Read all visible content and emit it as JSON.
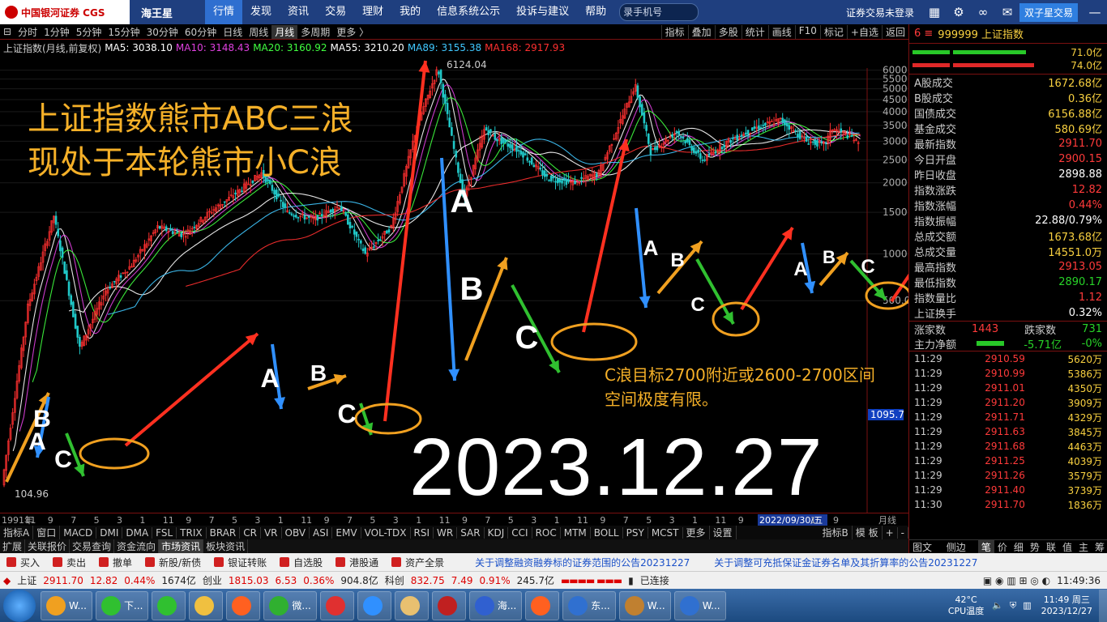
{
  "top": {
    "brand": "中国银河证券 CGS",
    "app_name": "海王星",
    "nav": [
      "行情",
      "发现",
      "资讯",
      "交易",
      "理财",
      "我的",
      "信息系统公示",
      "投诉与建议",
      "帮助"
    ],
    "search_placeholder": "录手机号",
    "login_status": "证券交易未登录",
    "account_button": "双子星交易"
  },
  "period_bar": {
    "items": [
      "分时",
      "1分钟",
      "5分钟",
      "15分钟",
      "30分钟",
      "60分钟",
      "日线",
      "周线",
      "月线",
      "多周期",
      "更多 〉"
    ],
    "selected": "月线",
    "right_items": [
      "指标",
      "叠加",
      "多股",
      "统计",
      "画线",
      "F10",
      "标记",
      "+自选",
      "返回"
    ]
  },
  "chart_header": {
    "name": "上证指数(月线,前复权)",
    "ma5": "MA5: 3038.10",
    "ma10": "MA10: 3148.43",
    "ma20": "MA20: 3160.92",
    "ma55": "MA55: 3210.20",
    "ma89": "MA89: 3155.38",
    "ma168": "MA168: 2917.93"
  },
  "annotations": {
    "headline1": "上证指数熊市ABC三浪",
    "headline2": "现处于本轮熊市小C浪",
    "target1": "C浪目标2700附近或2600-2700区间",
    "target2": "空间极度有限。",
    "date": "2023.12.27",
    "high_label": "6124.04",
    "low_label": "104.96",
    "price_tag": "1095.7",
    "wave_labels": [
      {
        "t": "A",
        "x": 46,
        "y": 555,
        "s": 30
      },
      {
        "t": "B",
        "x": 52,
        "y": 527,
        "s": 30
      },
      {
        "t": "C",
        "x": 78,
        "y": 577,
        "s": 30
      },
      {
        "t": "A",
        "x": 333,
        "y": 478,
        "s": 32
      },
      {
        "t": "B",
        "x": 393,
        "y": 470,
        "s": 28
      },
      {
        "t": "C",
        "x": 428,
        "y": 522,
        "s": 32
      },
      {
        "t": "A",
        "x": 570,
        "y": 262,
        "s": 40
      },
      {
        "t": "B",
        "x": 582,
        "y": 370,
        "s": 40
      },
      {
        "t": "C",
        "x": 650,
        "y": 430,
        "s": 40
      },
      {
        "t": "A",
        "x": 803,
        "y": 315,
        "s": 26
      },
      {
        "t": "B",
        "x": 836,
        "y": 329,
        "s": 24
      },
      {
        "t": "C",
        "x": 861,
        "y": 384,
        "s": 24
      },
      {
        "t": "A",
        "x": 988,
        "y": 340,
        "s": 24
      },
      {
        "t": "B",
        "x": 1023,
        "y": 325,
        "s": 22
      },
      {
        "t": "C",
        "x": 1071,
        "y": 337,
        "s": 24
      }
    ]
  },
  "chart_data": {
    "type": "candlestick",
    "title": "上证指数(月线,前复权)",
    "y_ticks": [
      500,
      1000,
      1500,
      2000,
      2500,
      3000,
      3500,
      4000,
      4500,
      5000,
      5500,
      6000
    ],
    "x_ticks": [
      "1991年",
      "11",
      "9",
      "7",
      "5",
      "3",
      "1",
      "11",
      "9",
      "7",
      "5",
      "3",
      "1",
      "11",
      "9",
      "7",
      "5",
      "3",
      "1",
      "11",
      "9",
      "7",
      "5",
      "3",
      "1",
      "11",
      "9",
      "7",
      "5",
      "3",
      "1",
      "11",
      "9",
      "7",
      "2022/09/30/五",
      "1",
      "9",
      "月线"
    ],
    "series": [
      {
        "name": "MA5",
        "color": "#ffffff"
      },
      {
        "name": "MA10",
        "color": "#e040e0"
      },
      {
        "name": "MA20",
        "color": "#40ff40"
      },
      {
        "name": "MA55",
        "color": "#ffffff"
      },
      {
        "name": "MA89",
        "color": "#40c8ff"
      },
      {
        "name": "MA168",
        "color": "#ff3030"
      }
    ],
    "path_points": [
      [
        1991,
        105
      ],
      [
        1992,
        600
      ],
      [
        1993,
        1450
      ],
      [
        1994,
        400
      ],
      [
        1995,
        700
      ],
      [
        1996,
        900
      ],
      [
        1997,
        1300
      ],
      [
        1998,
        1200
      ],
      [
        1999,
        1500
      ],
      [
        2000,
        1800
      ],
      [
        2001,
        2200
      ],
      [
        2002,
        1500
      ],
      [
        2003,
        1400
      ],
      [
        2004,
        1600
      ],
      [
        2005,
        1000
      ],
      [
        2006,
        1300
      ],
      [
        2007,
        3500
      ],
      [
        2007.8,
        6124
      ],
      [
        2008.8,
        1700
      ],
      [
        2009.6,
        3400
      ],
      [
        2010,
        3100
      ],
      [
        2011,
        2700
      ],
      [
        2012,
        2100
      ],
      [
        2013,
        2000
      ],
      [
        2014,
        2200
      ],
      [
        2015.4,
        5178
      ],
      [
        2016,
        2700
      ],
      [
        2017,
        3300
      ],
      [
        2018,
        2500
      ],
      [
        2019,
        3000
      ],
      [
        2020,
        3400
      ],
      [
        2021,
        3700
      ],
      [
        2022,
        3000
      ],
      [
        2022.7,
        2900
      ],
      [
        2023,
        3400
      ],
      [
        2023.8,
        3100
      ],
      [
        2023.99,
        2911.7
      ]
    ]
  },
  "bottom_axis_label": "月线",
  "indicator_tabs": [
    "指标A",
    "窗口",
    "MACD",
    "DMI",
    "DMA",
    "FSL",
    "TRIX",
    "BRAR",
    "CR",
    "VR",
    "OBV",
    "ASI",
    "EMV",
    "VOL-TDX",
    "RSI",
    "WR",
    "SAR",
    "KDJ",
    "CCI",
    "ROC",
    "MTM",
    "BOLL",
    "PSY",
    "MCST",
    "更多",
    "设置",
    "指标B",
    "模 板",
    "+",
    "-"
  ],
  "bottom_tabs": [
    "扩展",
    "关联报价",
    "交易查询",
    "资金流向",
    "市场资讯",
    "板块资讯"
  ],
  "bottom_tabs_selected": "市场资讯",
  "bottom_right": [
    "图文F10",
    "侧边栏《",
    "笔",
    "价",
    "细",
    "势",
    "联",
    "值",
    "主",
    "筹"
  ],
  "quote": {
    "code_title": "999999 上证指数",
    "bar1": "71.0亿",
    "bar2": "74.0亿",
    "rows": [
      {
        "label": "A股成交",
        "value": "1672.68亿",
        "c": "yel"
      },
      {
        "label": "B股成交",
        "value": "0.36亿",
        "c": "yel"
      },
      {
        "label": "国债成交",
        "value": "6156.88亿",
        "c": "yel"
      },
      {
        "label": "基金成交",
        "value": "580.69亿",
        "c": "yel"
      },
      {
        "label": "最新指数",
        "value": "2911.70",
        "c": "red"
      },
      {
        "label": "今日开盘",
        "value": "2900.15",
        "c": "red"
      },
      {
        "label": "昨日收盘",
        "value": "2898.88",
        "c": "wht"
      },
      {
        "label": "指数涨跌",
        "value": "12.82",
        "c": "red"
      },
      {
        "label": "指数涨幅",
        "value": "0.44%",
        "c": "red"
      },
      {
        "label": "指数振幅",
        "value": "22.88/0.79%",
        "c": "wht"
      },
      {
        "label": "总成交额",
        "value": "1673.68亿",
        "c": "yel"
      },
      {
        "label": "总成交量",
        "value": "14551.0万",
        "c": "yel"
      },
      {
        "label": "最高指数",
        "value": "2913.05",
        "c": "red"
      },
      {
        "label": "最低指数",
        "value": "2890.17",
        "c": "grn"
      },
      {
        "label": "指数量比",
        "value": "1.12",
        "c": "red"
      },
      {
        "label": "上证换手",
        "value": "0.32%",
        "c": "wht"
      }
    ],
    "up_label": "涨家数",
    "up": "1443",
    "down_label": "跌家数",
    "down": "731",
    "netflow_label": "主力净额",
    "netflow": "-5.71亿",
    "netflow_pct": "-0%"
  },
  "ticks": [
    {
      "t": "11:29",
      "p": "2910.59",
      "v": "5620万"
    },
    {
      "t": "11:29",
      "p": "2910.99",
      "v": "5386万"
    },
    {
      "t": "11:29",
      "p": "2911.01",
      "v": "4350万"
    },
    {
      "t": "11:29",
      "p": "2911.20",
      "v": "3909万"
    },
    {
      "t": "11:29",
      "p": "2911.71",
      "v": "4329万"
    },
    {
      "t": "11:29",
      "p": "2911.63",
      "v": "3845万"
    },
    {
      "t": "11:29",
      "p": "2911.68",
      "v": "4463万"
    },
    {
      "t": "11:29",
      "p": "2911.25",
      "v": "4039万"
    },
    {
      "t": "11:29",
      "p": "2911.26",
      "v": "3579万"
    },
    {
      "t": "11:29",
      "p": "2911.40",
      "v": "3739万"
    },
    {
      "t": "11:30",
      "p": "2911.70",
      "v": "1836万"
    }
  ],
  "toolbar": {
    "buttons": [
      "买入",
      "卖出",
      "撤单",
      "新股/新债",
      "银证转账",
      "自选股",
      "港股通",
      "资产全景"
    ],
    "news1": "关于调整融资融券标的证券范围的公告20231227",
    "news2": "关于调整可充抵保证金证券名单及其折算率的公告20231227"
  },
  "statusbar": {
    "sh_name": "上证",
    "sh_price": "2911.70",
    "sh_chg": "12.82",
    "sh_pct": "0.44%",
    "sh_amt": "1674亿",
    "cy_name": "创业",
    "cy_price": "1815.03",
    "cy_chg": "6.53",
    "cy_pct": "0.36%",
    "cy_amt": "904.8亿",
    "kc_name": "科创",
    "kc_price": "832.75",
    "kc_chg": "7.49",
    "kc_pct": "0.91%",
    "kc_amt": "245.7亿",
    "conn": "已连接",
    "time": "11:49:36"
  },
  "taskbar": {
    "tasks": [
      "W...",
      "下...",
      "",
      "",
      "",
      "微...",
      "",
      "",
      "",
      "",
      "海...",
      "",
      "东...",
      "W...",
      "W..."
    ],
    "temp": "42°C",
    "cpu": "CPU温度",
    "clock": "11:49 周三",
    "date": "2023/12/27"
  }
}
